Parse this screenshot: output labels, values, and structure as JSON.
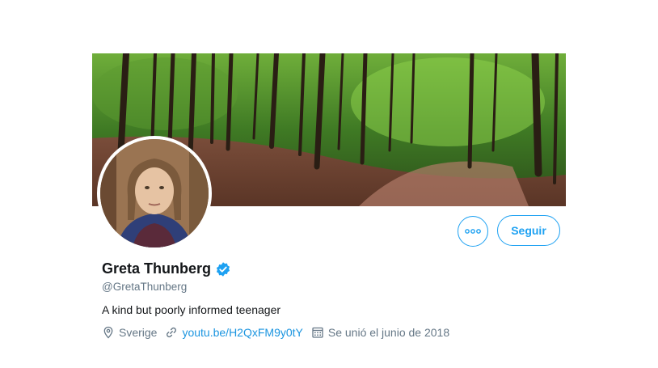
{
  "profile": {
    "display_name": "Greta Thunberg",
    "verified": true,
    "handle": "@GretaThunberg",
    "bio": "A kind but poorly informed teenager",
    "location": "Sverige",
    "website": "youtu.be/H2QxFM9y0tY",
    "joined": "Se unió el junio de 2018"
  },
  "actions": {
    "follow_label": "Seguir",
    "more_icon": "more-horizontal-icon"
  },
  "colors": {
    "accent": "#1da1f2",
    "link": "#1b95e0",
    "secondary_text": "#657786",
    "primary_text": "#14171a"
  }
}
